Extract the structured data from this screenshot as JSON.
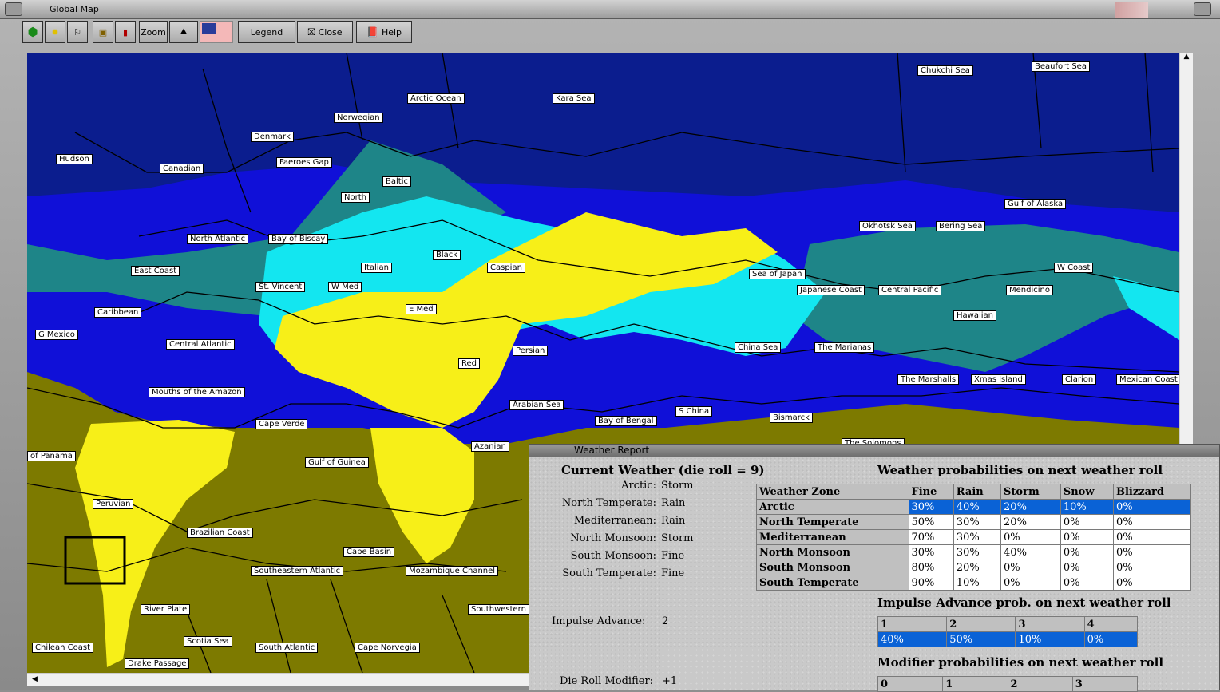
{
  "window": {
    "title": "Global Map"
  },
  "toolbar": {
    "zoom": "Zoom",
    "legend": "Legend",
    "close": "Close",
    "help": "Help"
  },
  "map_labels": [
    "Chukchi Sea",
    "Beaufort Sea",
    "Arctic Ocean",
    "Kara Sea",
    "Norwegian",
    "Denmark",
    "Hudson",
    "Canadian",
    "Faeroes Gap",
    "Baltic",
    "North",
    "Gulf of Alaska",
    "Okhotsk Sea",
    "Bering Sea",
    "North Atlantic",
    "Bay of Biscay",
    "Black",
    "Caspian",
    "Italian",
    "East Coast",
    "St. Vincent",
    "W Med",
    "Sea of Japan",
    "W Coast",
    "Japanese Coast",
    "Central Pacific",
    "Mendicino",
    "Caribbean",
    "E Med",
    "Hawaiian",
    "G Mexico",
    "Central Atlantic",
    "Persian",
    "China Sea",
    "The Marianas",
    "Red",
    "The Marshalls",
    "Xmas Island",
    "Clarion",
    "Mexican Coast",
    "Mouths of the Amazon",
    "Arabian Sea",
    "S China",
    "Bismarck",
    "Cape Verde",
    "Bay of Bengal",
    "The Solomons",
    "Azanian",
    "of Panama",
    "Gulf of Guinea",
    "Peruvian",
    "Brazilian Coast",
    "Cape Basin",
    "Southeastern Atlantic",
    "Mozambique Channel",
    "River Plate",
    "Southwestern",
    "Scotia Sea",
    "Chilean Coast",
    "South Atlantic",
    "Cape Norvegia",
    "Drake Passage"
  ],
  "weather": {
    "title": "Weather Report",
    "current_heading": "Current Weather (die roll = 9)",
    "current": [
      {
        "zone": "Arctic:",
        "value": "Storm"
      },
      {
        "zone": "North Temperate:",
        "value": "Rain"
      },
      {
        "zone": "Mediterranean:",
        "value": "Rain"
      },
      {
        "zone": "North Monsoon:",
        "value": "Storm"
      },
      {
        "zone": "South Monsoon:",
        "value": "Fine"
      },
      {
        "zone": "South Temperate:",
        "value": "Fine"
      }
    ],
    "prob_heading": "Weather probabilities on next weather roll",
    "columns": [
      "Weather Zone",
      "Fine",
      "Rain",
      "Storm",
      "Snow",
      "Blizzard"
    ],
    "rows": [
      [
        "Arctic",
        "30%",
        "40%",
        "20%",
        "10%",
        "0%"
      ],
      [
        "North Temperate",
        "50%",
        "30%",
        "20%",
        "0%",
        "0%"
      ],
      [
        "Mediterranean",
        "70%",
        "30%",
        "0%",
        "0%",
        "0%"
      ],
      [
        "North Monsoon",
        "30%",
        "30%",
        "40%",
        "0%",
        "0%"
      ],
      [
        "South Monsoon",
        "80%",
        "20%",
        "0%",
        "0%",
        "0%"
      ],
      [
        "South Temperate",
        "90%",
        "10%",
        "0%",
        "0%",
        "0%"
      ]
    ],
    "impulse_label": "Impulse Advance:",
    "impulse_value": "2",
    "impulse_heading": "Impulse Advance prob. on next weather roll",
    "impulse_cols": [
      "1",
      "2",
      "3",
      "4"
    ],
    "impulse_vals": [
      "40%",
      "50%",
      "10%",
      "0%"
    ],
    "modifier_heading": "Modifier probabilities on next weather roll",
    "modifier_cols": [
      "0",
      "1",
      "2",
      "3"
    ],
    "die_label": "Die Roll Modifier:",
    "die_value": "+1"
  }
}
